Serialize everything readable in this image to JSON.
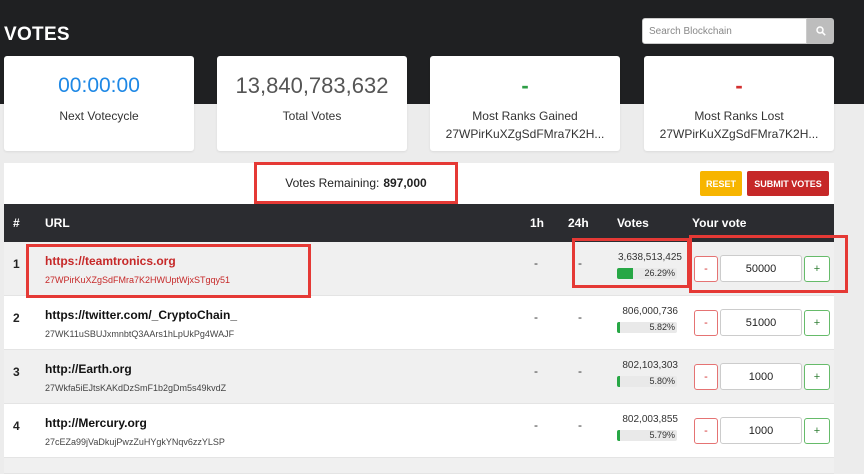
{
  "page_title": "VOTES",
  "search": {
    "placeholder": "Search Blockchain"
  },
  "stats": [
    {
      "value": "00:00:00",
      "label": "Next Votecycle",
      "sub": ""
    },
    {
      "value": "13,840,783,632",
      "label": "Total Votes",
      "sub": ""
    },
    {
      "value": "-",
      "label": "Most Ranks Gained",
      "sub": "27WPirKuXZgSdFMra7K2H..."
    },
    {
      "value": "-",
      "label": "Most Ranks Lost",
      "sub": "27WPirKuXZgSdFMra7K2H..."
    }
  ],
  "votes_remaining": {
    "label": "Votes Remaining:",
    "value": "897,000"
  },
  "buttons": {
    "reset": "RESET",
    "submit": "SUBMIT VOTES"
  },
  "table": {
    "headers": [
      "#",
      "URL",
      "1h",
      "24h",
      "Votes",
      "Your vote"
    ],
    "rows": [
      {
        "rank": "1",
        "url": "https://teamtronics.org",
        "address": "27WPirKuXZgSdFMra7K2HWUptWjxSTgqy51",
        "h1": "-",
        "h24": "-",
        "votes": "3,638,513,425",
        "pct": "26.29%",
        "pct_value": 26.29,
        "your_vote": "50000",
        "minus": "-",
        "plus": "+"
      },
      {
        "rank": "2",
        "url": "https://twitter.com/_CryptoChain_",
        "address": "27WK11uSBUJxmnbtQ3AArs1hLpUkPg4WAJF",
        "h1": "-",
        "h24": "-",
        "votes": "806,000,736",
        "pct": "5.82%",
        "pct_value": 5.82,
        "your_vote": "51000",
        "minus": "-",
        "plus": "+"
      },
      {
        "rank": "3",
        "url": "http://Earth.org",
        "address": "27Wkfa5iEJtsKAKdDzSmF1b2gDm5s49kvdZ",
        "h1": "-",
        "h24": "-",
        "votes": "802,103,303",
        "pct": "5.80%",
        "pct_value": 5.8,
        "your_vote": "1000",
        "minus": "-",
        "plus": "+"
      },
      {
        "rank": "4",
        "url": "http://Mercury.org",
        "address": "27cEZa99jVaDkujPwzZuHYgkYNqv6zzYLSP",
        "h1": "-",
        "h24": "-",
        "votes": "802,003,855",
        "pct": "5.79%",
        "pct_value": 5.79,
        "your_vote": "1000",
        "minus": "-",
        "plus": "+"
      }
    ]
  },
  "colors": {
    "positive": "#2e9e46",
    "negative": "#d32f2f",
    "accent": "#1e88e5",
    "highlight": "#e53935"
  }
}
